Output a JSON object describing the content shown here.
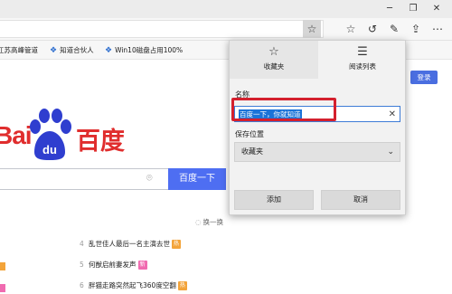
{
  "window": {
    "minimize": "─",
    "maximize": "❐",
    "close": "✕"
  },
  "toolbar": {
    "star_icon": "☆",
    "favorites_icon": "☆",
    "history_icon": "↺",
    "pen_icon": "✎",
    "share_icon": "⇪",
    "more_icon": "⋯"
  },
  "favorites_bar": {
    "items": [
      {
        "label": "江苏高峰管道"
      },
      {
        "label": "知道合伙人"
      },
      {
        "label": "Win10磁盘占用100%"
      }
    ]
  },
  "page": {
    "login_label": "登录",
    "logo_latin": "Bai",
    "logo_du": "du",
    "logo_cn": "百度",
    "camera_icon": "⌾",
    "search_button": "百度一下",
    "refresh_label": "换一换",
    "hot_list": [
      {
        "rank": "4",
        "title": "乱世佳人最后一名主演去世",
        "tag": "热",
        "tag_color": "#f3a43a"
      },
      {
        "rank": "5",
        "title": "何猷启前妻发声",
        "tag": "新",
        "tag_color": "#f06bb0"
      },
      {
        "rank": "6",
        "title": "胖猫走路突然起飞360度空翻",
        "tag": "热",
        "tag_color": "#f3a43a"
      }
    ]
  },
  "flyout": {
    "tabs": [
      {
        "icon": "☆",
        "label": "收藏夹"
      },
      {
        "icon": "☰",
        "label": "阅读列表"
      }
    ],
    "name_label": "名称",
    "name_value": "百度一下，你就知道",
    "clear_icon": "✕",
    "location_label": "保存位置",
    "location_value": "收藏夹",
    "chevron_icon": "⌄",
    "add_button": "添加",
    "cancel_button": "取消"
  },
  "colors": {
    "accent": "#4e6ef2",
    "highlight_box": "#d4202e",
    "selection": "#1a73d8",
    "baidu_red": "#e02d2d",
    "baidu_blue": "#2f3ecf"
  }
}
